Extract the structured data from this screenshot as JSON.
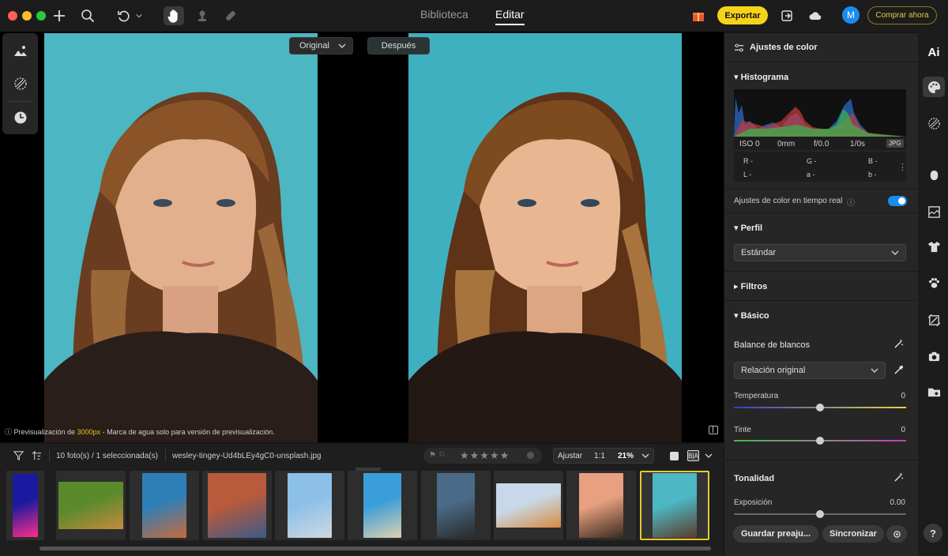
{
  "topbar": {
    "tabs": [
      {
        "label": "Biblioteca",
        "active": false
      },
      {
        "label": "Editar",
        "active": true
      }
    ],
    "export_label": "Exportar",
    "buy_label": "Comprar ahora",
    "avatar_initial": "M",
    "icons": [
      "plus-icon",
      "search-icon",
      "undo-icon",
      "chevron-down-icon",
      "hand-icon",
      "stamp-icon",
      "bandage-icon",
      "gift-icon",
      "export-box-icon",
      "cloud-icon"
    ]
  },
  "view": {
    "original_label": "Original",
    "after_label": "Después",
    "watermark_prefix": "Previsualización de ",
    "watermark_size": "3000px",
    "watermark_suffix": " - Marca de agua solo para versión de previsualización."
  },
  "filmstrip": {
    "count_label": "10 foto(s) / 1 seleccionada(s)",
    "filename": "wesley-tingey-Ud4bLEy4gC0-unsplash.jpg",
    "fit_label": "Ajustar",
    "ratio_label": "1:1",
    "zoom": "21%",
    "thumbs": [
      {
        "name": "neon",
        "colors": [
          "#1a1aa0",
          "#ff2e88"
        ]
      },
      {
        "name": "puppies",
        "colors": [
          "#5b8a2c",
          "#c58b3e"
        ]
      },
      {
        "name": "houses",
        "colors": [
          "#2e7fb8",
          "#c86a3c"
        ]
      },
      {
        "name": "alley",
        "colors": [
          "#b85a3c",
          "#3a5a8a"
        ]
      },
      {
        "name": "city",
        "colors": [
          "#8cc0e8",
          "#d0d8e0"
        ]
      },
      {
        "name": "beach",
        "colors": [
          "#3a9ed8",
          "#e0d0b0"
        ]
      },
      {
        "name": "cliff",
        "colors": [
          "#4a6a88",
          "#2a2a2a"
        ]
      },
      {
        "name": "balloons",
        "colors": [
          "#c8d8e8",
          "#d88a3c"
        ]
      },
      {
        "name": "woman",
        "colors": [
          "#e8a080",
          "#3a2a20"
        ]
      },
      {
        "name": "selected",
        "colors": [
          "#4db8c4",
          "#5a3a28"
        ]
      }
    ]
  },
  "panel": {
    "header": "Ajustes de color",
    "histogram": {
      "title": "Histograma",
      "iso": "ISO 0",
      "focal": "0mm",
      "aperture": "f/0.0",
      "shutter": "1/0s",
      "format": "JPG",
      "r": "R -",
      "g": "G -",
      "b": "B -",
      "l": "L -",
      "a": "a -",
      "bb": "b -"
    },
    "realtime_label": "Ajustes de color en tiempo real",
    "realtime_on": true,
    "profile": {
      "title": "Perfil",
      "value": "Estándar"
    },
    "filters_title": "Filtros",
    "basic_title": "Básico",
    "wb_title": "Balance de blancos",
    "wb_value": "Relación original",
    "temperature": {
      "label": "Temperatura",
      "value": "0",
      "pos": 0.5
    },
    "tint": {
      "label": "Tinte",
      "value": "0",
      "pos": 0.5
    },
    "tone_title": "Tonalidad",
    "exposure": {
      "label": "Exposición",
      "value": "0.00",
      "pos": 0.5
    },
    "save_preset": "Guardar preaju...",
    "sync": "Sincronizar"
  },
  "rail": {
    "ai_label": "Ai",
    "help": "?"
  },
  "colors": {
    "accent": "#f5d31a",
    "toggle": "#1a8cf0",
    "selected_border": "#e8c72e"
  }
}
